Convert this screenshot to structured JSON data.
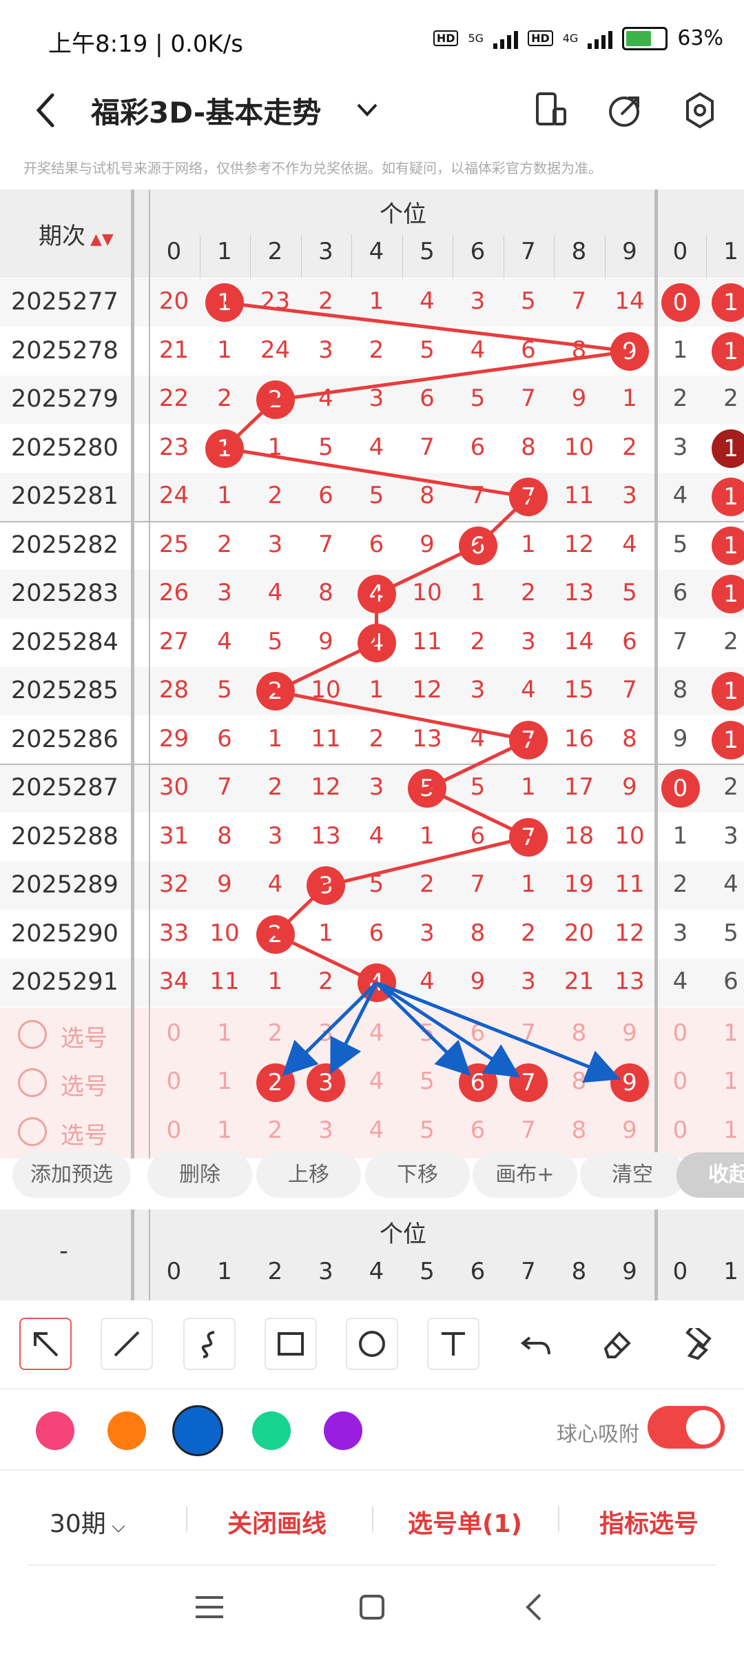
{
  "status": {
    "time": "上午8:19 | 0.0K/s",
    "battery": "63%",
    "hd1": "HD",
    "net1": "5G",
    "hd2": "HD",
    "net2": "4G"
  },
  "header": {
    "title": "福彩3D-基本走势"
  },
  "notice": "开奖结果与试机号来源于网络，仅供参考不作为兑奖依据。如有疑问，以福体彩官方数据为准。",
  "table": {
    "period_label": "期次",
    "group_label": "个位",
    "digits": [
      "0",
      "1",
      "2",
      "3",
      "4",
      "5",
      "6",
      "7",
      "8",
      "9",
      "0",
      "1"
    ],
    "rows": [
      {
        "period": "2025277",
        "win": 1,
        "values": [
          "20",
          "1",
          "23",
          "2",
          "1",
          "4",
          "3",
          "5",
          "7",
          "14",
          "0",
          "1"
        ]
      },
      {
        "period": "2025278",
        "win": 9,
        "values": [
          "21",
          "1",
          "24",
          "3",
          "2",
          "5",
          "4",
          "6",
          "8",
          "9",
          "1",
          "1"
        ]
      },
      {
        "period": "2025279",
        "win": 2,
        "values": [
          "22",
          "2",
          "2",
          "4",
          "3",
          "6",
          "5",
          "7",
          "9",
          "1",
          "2",
          "2"
        ]
      },
      {
        "period": "2025280",
        "win": 1,
        "values": [
          "23",
          "1",
          "1",
          "5",
          "4",
          "7",
          "6",
          "8",
          "10",
          "2",
          "3",
          "1"
        ]
      },
      {
        "period": "2025281",
        "win": 7,
        "values": [
          "24",
          "1",
          "2",
          "6",
          "5",
          "8",
          "7",
          "7",
          "11",
          "3",
          "4",
          "1"
        ]
      },
      {
        "period": "2025282",
        "win": 6,
        "values": [
          "25",
          "2",
          "3",
          "7",
          "6",
          "9",
          "6",
          "1",
          "12",
          "4",
          "5",
          "1"
        ]
      },
      {
        "period": "2025283",
        "win": 4,
        "values": [
          "26",
          "3",
          "4",
          "8",
          "4",
          "10",
          "1",
          "2",
          "13",
          "5",
          "6",
          "1"
        ]
      },
      {
        "period": "2025284",
        "win": 4,
        "values": [
          "27",
          "4",
          "5",
          "9",
          "4",
          "11",
          "2",
          "3",
          "14",
          "6",
          "7",
          "2"
        ]
      },
      {
        "period": "2025285",
        "win": 2,
        "values": [
          "28",
          "5",
          "2",
          "10",
          "1",
          "12",
          "3",
          "4",
          "15",
          "7",
          "8",
          "1"
        ]
      },
      {
        "period": "2025286",
        "win": 7,
        "values": [
          "29",
          "6",
          "1",
          "11",
          "2",
          "13",
          "4",
          "7",
          "16",
          "8",
          "9",
          "1"
        ]
      },
      {
        "period": "2025287",
        "win": 5,
        "values": [
          "30",
          "7",
          "2",
          "12",
          "3",
          "5",
          "5",
          "1",
          "17",
          "9",
          "0",
          "2"
        ]
      },
      {
        "period": "2025288",
        "win": 7,
        "values": [
          "31",
          "8",
          "3",
          "13",
          "4",
          "1",
          "6",
          "7",
          "18",
          "10",
          "1",
          "3"
        ]
      },
      {
        "period": "2025289",
        "win": 3,
        "values": [
          "32",
          "9",
          "4",
          "3",
          "5",
          "2",
          "7",
          "1",
          "19",
          "11",
          "2",
          "4"
        ]
      },
      {
        "period": "2025290",
        "win": 2,
        "values": [
          "33",
          "10",
          "2",
          "1",
          "6",
          "3",
          "8",
          "2",
          "20",
          "12",
          "3",
          "5"
        ]
      },
      {
        "period": "2025291",
        "win": 4,
        "values": [
          "34",
          "11",
          "1",
          "2",
          "4",
          "4",
          "9",
          "3",
          "21",
          "13",
          "4",
          "6"
        ]
      }
    ],
    "select_label": "选号",
    "select_rows": [
      {
        "selected": []
      },
      {
        "selected": [
          2,
          3,
          6,
          7,
          9
        ]
      },
      {
        "selected": []
      }
    ]
  },
  "actions": {
    "add": "添加预选",
    "delete": "删除",
    "up": "上移",
    "down": "下移",
    "canvas": "画布+",
    "clear": "清空",
    "collapse": "收起"
  },
  "bottom_head": {
    "dash": "-",
    "group_label": "个位"
  },
  "tools": [
    "arrow-tool",
    "line-tool",
    "curve-tool",
    "rect-tool",
    "circle-tool",
    "text-tool",
    "undo-tool",
    "eraser-tool",
    "clear-brush-tool"
  ],
  "colors": {
    "swatches": [
      "#f4447a",
      "#ff7a0f",
      "#0b64c9",
      "#16d38f",
      "#9a1ee0"
    ],
    "accent": "#e83c3c",
    "draw_line": "#e83c3c",
    "draw_arrow": "#1461c8"
  },
  "snap_label": "球心吸附",
  "bottom_bar": {
    "periods": "30期",
    "close_draw": "关闭画线",
    "selection": "选号单(1)",
    "indicator": "指标选号"
  }
}
